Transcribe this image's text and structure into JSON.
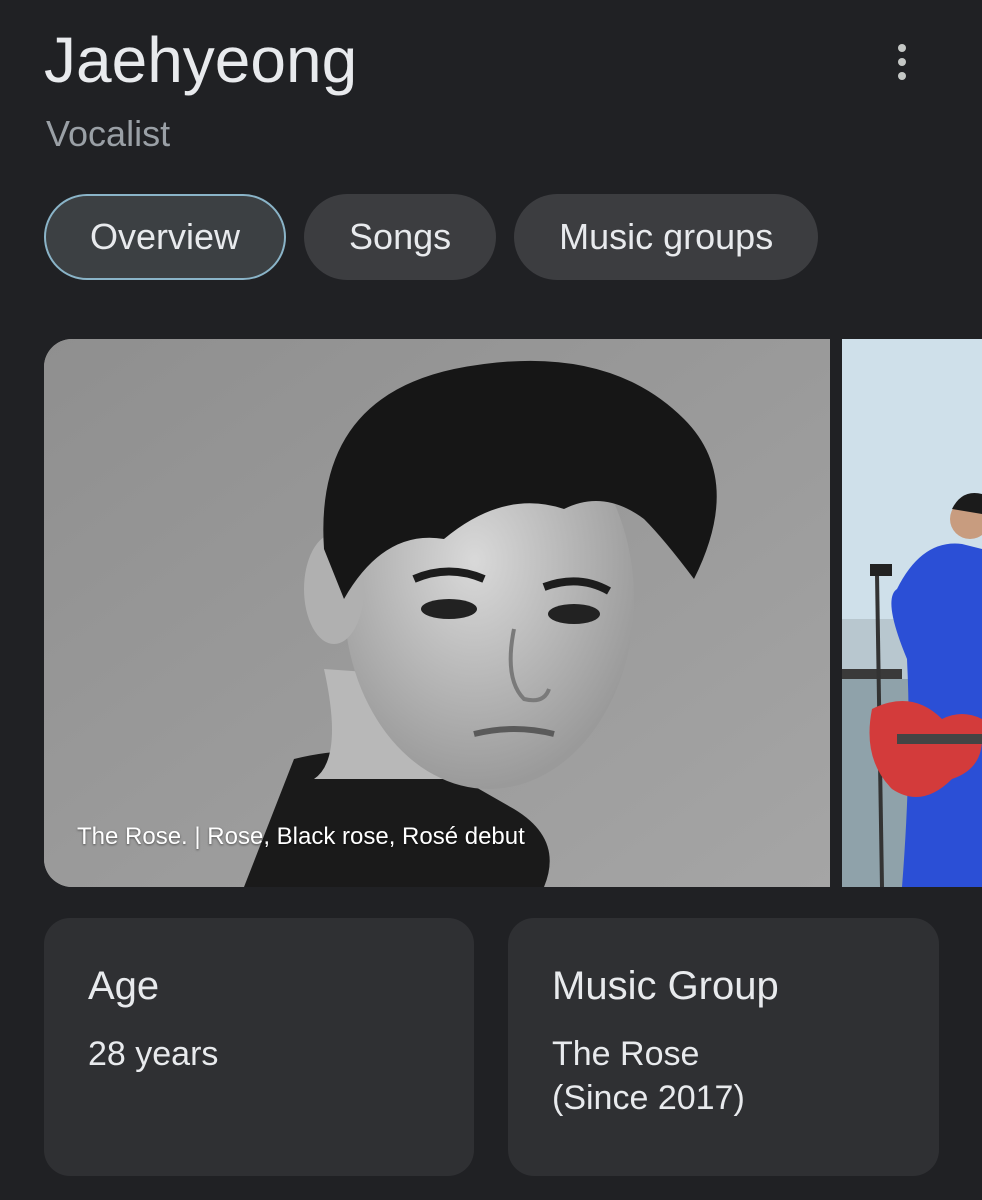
{
  "header": {
    "title": "Jaehyeong",
    "subtitle": "Vocalist",
    "more_icon": "more-vert-icon"
  },
  "tabs": [
    {
      "label": "Overview",
      "active": true
    },
    {
      "label": "Songs",
      "active": false
    },
    {
      "label": "Music groups",
      "active": false
    }
  ],
  "images": {
    "main_caption": "The Rose. | Rose, Black rose, Rosé debut"
  },
  "facts": {
    "age": {
      "label": "Age",
      "value": "28 years"
    },
    "music_group": {
      "label": "Music Group",
      "value_line1": "The Rose",
      "value_line2": "(Since 2017)"
    }
  },
  "colors": {
    "background": "#202124",
    "chip": "#3c3d40",
    "active_chip_border": "#8ab4c8",
    "card": "#2f3033",
    "text": "#e8eaed",
    "muted_text": "#9aa0a6"
  }
}
